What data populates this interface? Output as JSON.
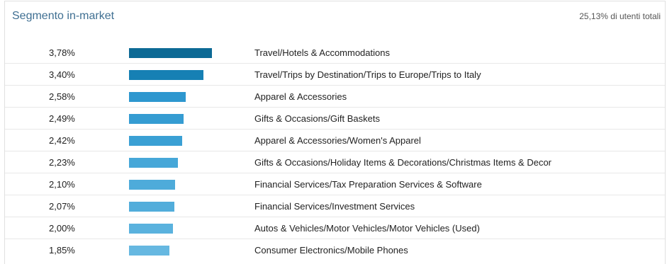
{
  "header": {
    "title": "Segmento in-market",
    "total": "25,13% di utenti totali"
  },
  "rows": [
    {
      "percent_text": "3,78%",
      "value": 3.78,
      "color": "#0d6a95",
      "label": "Travel/Hotels & Accommodations"
    },
    {
      "percent_text": "3,40%",
      "value": 3.4,
      "color": "#1680b4",
      "label": "Travel/Trips by Destination/Trips to Europe/Trips to Italy"
    },
    {
      "percent_text": "2,58%",
      "value": 2.58,
      "color": "#2e97cf",
      "label": "Apparel & Accessories"
    },
    {
      "percent_text": "2,49%",
      "value": 2.49,
      "color": "#359cd2",
      "label": "Gifts & Occasions/Gift Baskets"
    },
    {
      "percent_text": "2,42%",
      "value": 2.42,
      "color": "#3aa0d4",
      "label": "Apparel & Accessories/Women's Apparel"
    },
    {
      "percent_text": "2,23%",
      "value": 2.23,
      "color": "#46a7d8",
      "label": "Gifts & Occasions/Holiday Items & Decorations/Christmas Items & Decor"
    },
    {
      "percent_text": "2,10%",
      "value": 2.1,
      "color": "#4eabda",
      "label": "Financial Services/Tax Preparation Services & Software"
    },
    {
      "percent_text": "2,07%",
      "value": 2.07,
      "color": "#52addb",
      "label": "Financial Services/Investment Services"
    },
    {
      "percent_text": "2,00%",
      "value": 2.0,
      "color": "#5ab2de",
      "label": "Autos & Vehicles/Motor Vehicles/Motor Vehicles (Used)"
    },
    {
      "percent_text": "1,85%",
      "value": 1.85,
      "color": "#66b8e1",
      "label": "Consumer Electronics/Mobile Phones"
    }
  ]
}
